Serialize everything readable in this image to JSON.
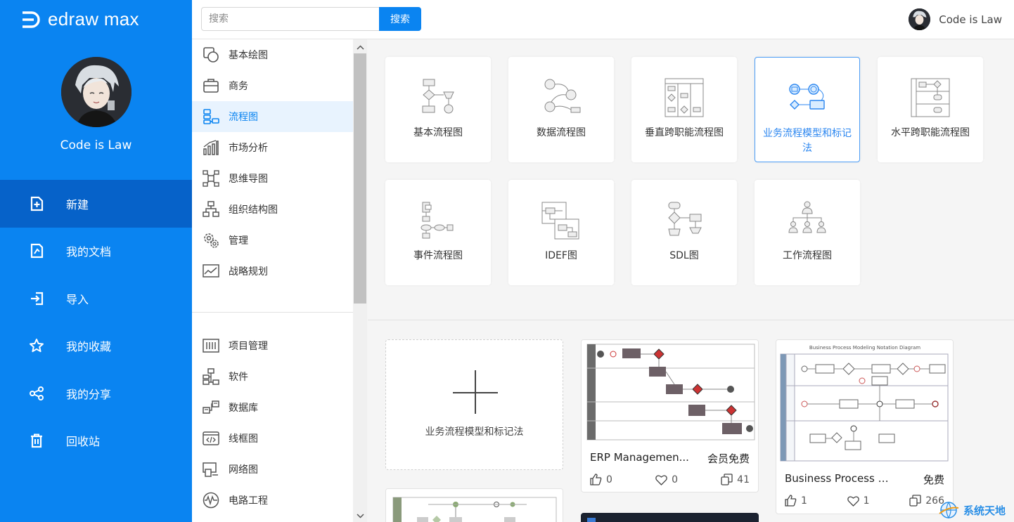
{
  "brand": {
    "name": "edraw max"
  },
  "user": {
    "name": "Code is Law"
  },
  "nav": [
    {
      "label": "新建",
      "icon": "new-file-icon"
    },
    {
      "label": "我的文档",
      "icon": "document-icon"
    },
    {
      "label": "导入",
      "icon": "import-icon"
    },
    {
      "label": "我的收藏",
      "icon": "star-icon"
    },
    {
      "label": "我的分享",
      "icon": "share-icon"
    },
    {
      "label": "回收站",
      "icon": "trash-icon"
    }
  ],
  "search": {
    "placeholder": "搜索",
    "button": "搜索"
  },
  "categories": [
    "基本绘图",
    "商务",
    "流程图",
    "市场分析",
    "思维导图",
    "组织结构图",
    "管理",
    "战略规划"
  ],
  "categories2": [
    "项目管理",
    "软件",
    "数据库",
    "线框图",
    "网络图",
    "电路工程"
  ],
  "templates": [
    "基本流程图",
    "数据流程图",
    "垂直跨职能流程图",
    "业务流程模型和标记法",
    "水平跨职能流程图",
    "事件流程图",
    "IDEF图",
    "SDL图",
    "工作流程图"
  ],
  "new_card": {
    "label": "业务流程模型和标记法"
  },
  "examples": [
    {
      "title": "ERP Managemen...",
      "price": "会员免费",
      "likes": "0",
      "favorites": "0",
      "copies": "41"
    },
    {
      "title": "Business Process Mo...",
      "price": "免费",
      "likes": "1",
      "favorites": "1",
      "copies": "266",
      "thumb_title": "Business Process Modeling Notation Diagram"
    }
  ],
  "watermark": {
    "text": "系统天地"
  },
  "colors": {
    "accent": "#0a84f1",
    "sidebar_active": "#0662c9",
    "selected_border": "#4a9cf5"
  }
}
